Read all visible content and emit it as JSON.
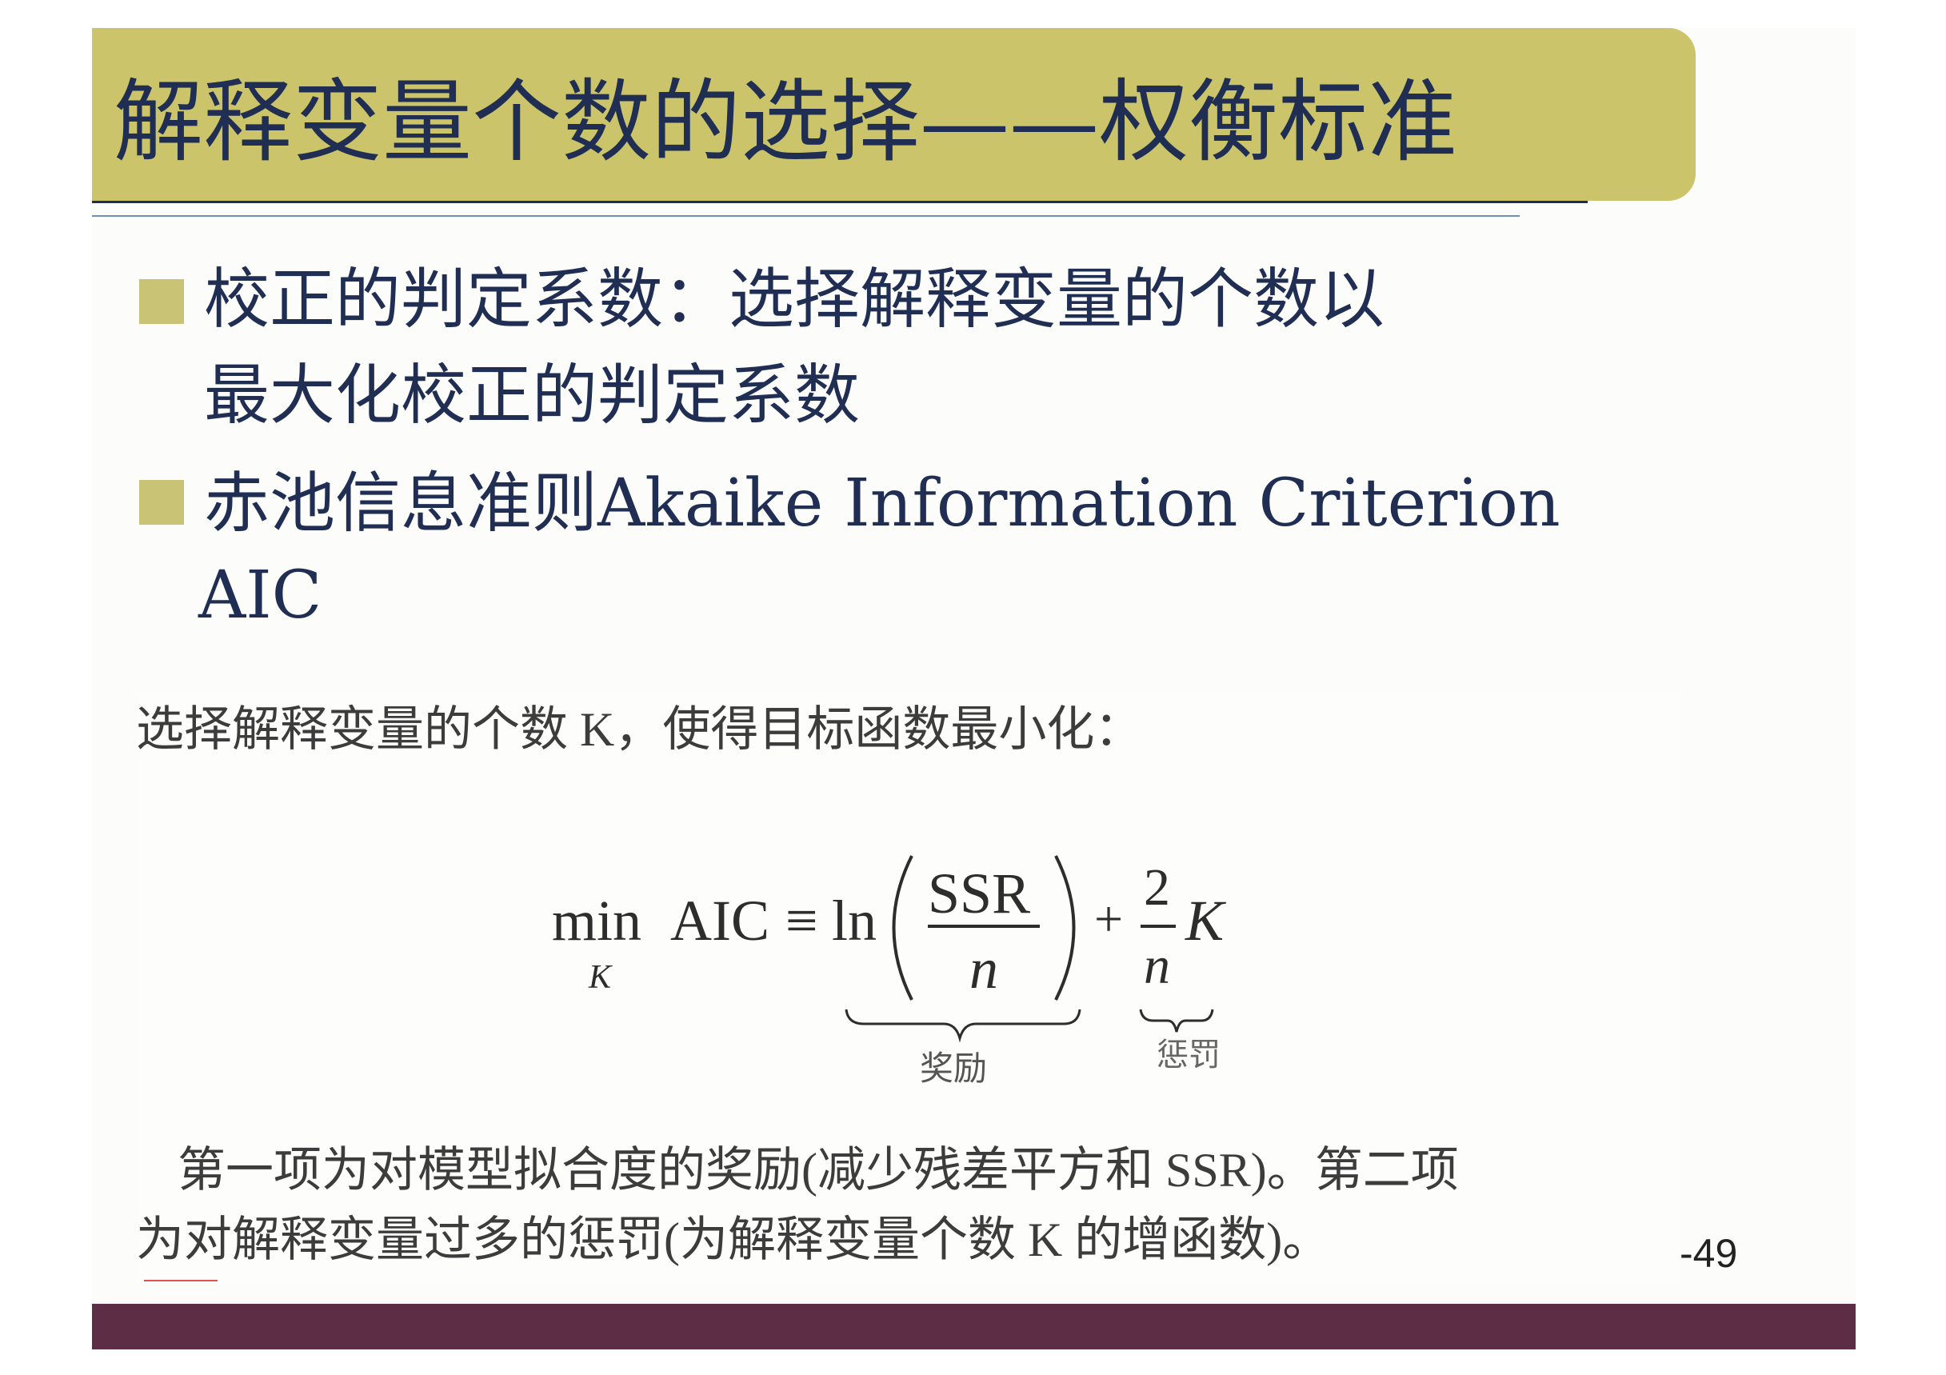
{
  "title": "解释变量个数的选择——权衡标准",
  "bullets": [
    {
      "line1": "校正的判定系数：选择解释变量的个数以",
      "line2": "最大化校正的判定系数"
    },
    {
      "line1": "赤池信息准则Akaike Information Criterion",
      "line2": "AIC"
    }
  ],
  "panel": {
    "intro": "选择解释变量的个数 K，使得目标函数最小化：",
    "formula": {
      "min": "min",
      "min_sub": "K",
      "aic": "AIC",
      "equiv": "≡",
      "ln": "ln",
      "numerator": "SSR",
      "denominator": "n",
      "plus": "+",
      "frac2_num": "2",
      "frac2_den": "n",
      "k": "K",
      "brace1_label": "奖励",
      "brace2_label": "惩罚"
    },
    "explanation_line1": "第一项为对模型拟合度的奖励(减少残差平方和  SSR)。第二项",
    "explanation_line2": "为对解释变量过多的惩罚(为解释变量个数 K 的增函数)。"
  },
  "page_number": "-49",
  "colors": {
    "title_bar": "#cbc46a",
    "title_text": "#1f2e52",
    "bullet": "#c9c475",
    "footer": "#5d2d45"
  }
}
